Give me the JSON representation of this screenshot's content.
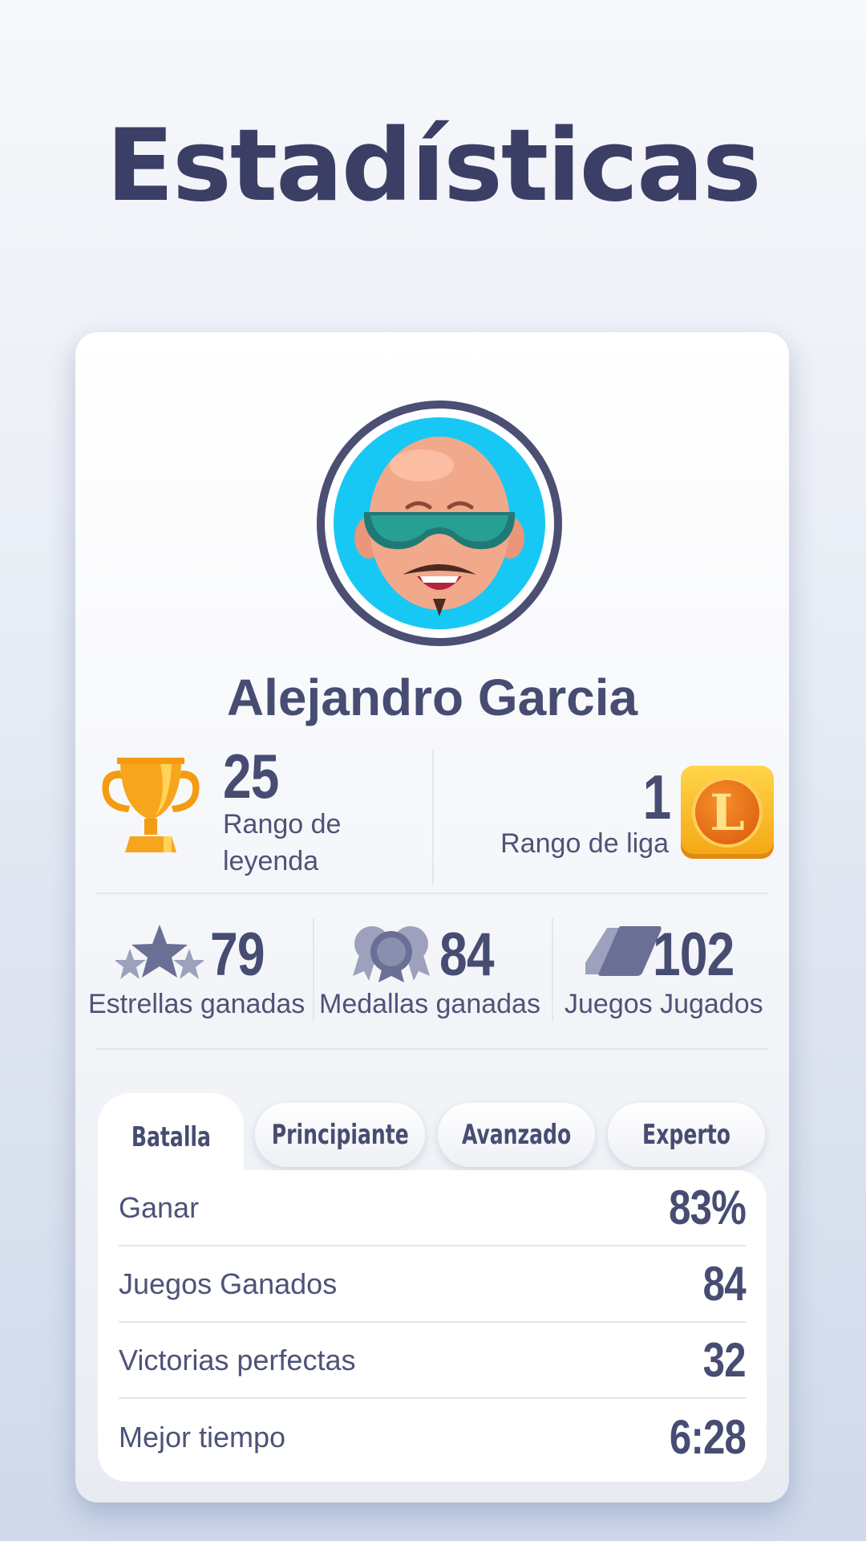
{
  "page": {
    "title": "Estadísticas"
  },
  "profile": {
    "name": "Alejandro Garcia",
    "avatar_icon": "bald-man-sunglasses-avatar",
    "avatar_bg": "#18c8f4"
  },
  "ranks": {
    "legend": {
      "value": "25",
      "label": "Rango de leyenda",
      "icon": "trophy-icon"
    },
    "league": {
      "value": "1",
      "label": "Rango de liga",
      "icon": "league-L-badge-icon",
      "badge_letter": "L"
    }
  },
  "stats": [
    {
      "value": "79",
      "label": "Estrellas ganadas",
      "icon": "stars-icon"
    },
    {
      "value": "84",
      "label": "Medallas ganadas",
      "icon": "medals-icon"
    },
    {
      "value": "102",
      "label": "Juegos Jugados",
      "icon": "cards-icon"
    }
  ],
  "tabs": [
    {
      "label": "Batalla",
      "active": true
    },
    {
      "label": "Principiante",
      "active": false
    },
    {
      "label": "Avanzado",
      "active": false
    },
    {
      "label": "Experto",
      "active": false
    }
  ],
  "table": [
    {
      "label": "Ganar",
      "value": "83%"
    },
    {
      "label": "Juegos Ganados",
      "value": "84"
    },
    {
      "label": "Victorias perfectas",
      "value": "32"
    },
    {
      "label": "Mejor tiempo",
      "value": "6:28"
    }
  ],
  "colors": {
    "text": "#474c72",
    "title": "#3b3f66",
    "trophy": "#f7a51c"
  }
}
